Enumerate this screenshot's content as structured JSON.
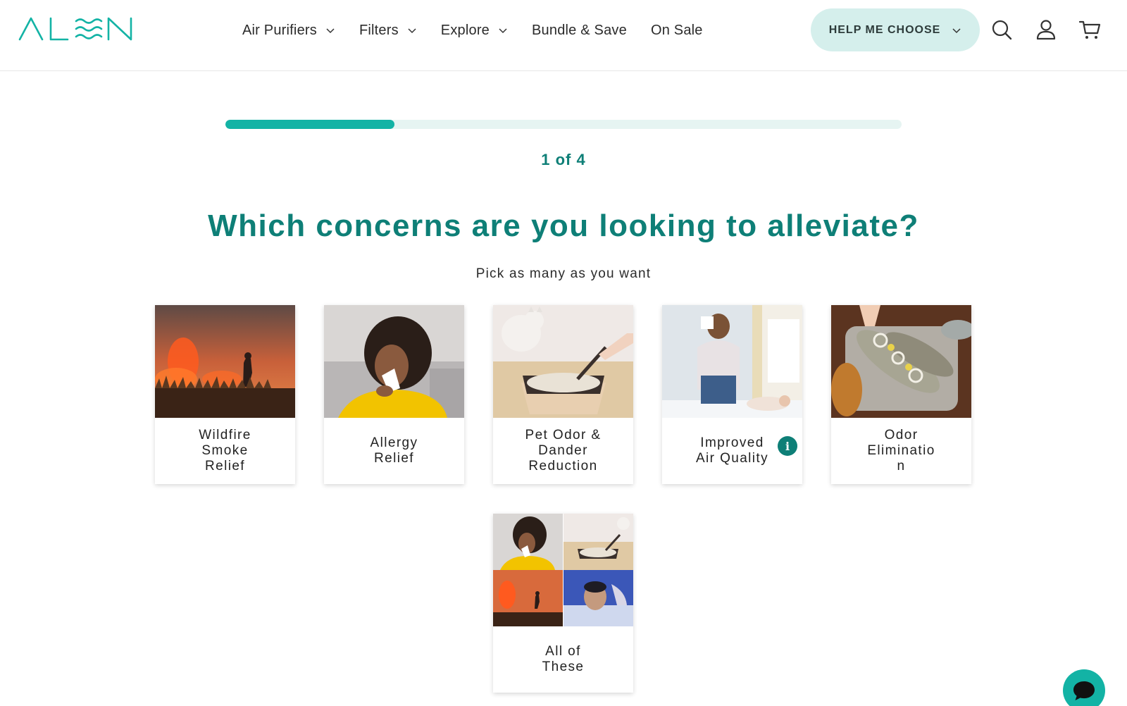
{
  "brand": {
    "logo_text": "ALEN",
    "accent": "#13b3a5",
    "dark_accent": "#0e7f77"
  },
  "nav": {
    "items": [
      {
        "label": "Air Purifiers",
        "has_dropdown": true
      },
      {
        "label": "Filters",
        "has_dropdown": true
      },
      {
        "label": "Explore",
        "has_dropdown": true
      },
      {
        "label": "Bundle & Save",
        "has_dropdown": false
      },
      {
        "label": "On Sale",
        "has_dropdown": false
      }
    ],
    "help_button": "HELP ME CHOOSE",
    "icons": [
      "search-icon",
      "account-icon",
      "cart-icon"
    ]
  },
  "quiz": {
    "progress_fraction": 0.25,
    "step_text": "1 of 4",
    "question": "Which concerns are you looking to alleviate?",
    "subtext": "Pick as many as you want",
    "options": [
      {
        "label": "Wildfire\nSmoke\nRelief",
        "image": "wildfire-firefighter-photo"
      },
      {
        "label": "Allergy\nRelief",
        "image": "woman-sneezing-photo"
      },
      {
        "label": "Pet Odor &\nDander\nReduction",
        "image": "cat-litter-box-photo"
      },
      {
        "label": "Improved\nAir Quality",
        "image": "mother-baby-nursery-photo",
        "info": "i"
      },
      {
        "label": "Odor\nEliminatio\nn",
        "image": "fish-dish-photo"
      },
      {
        "label": "All of\nThese",
        "image": "collage-photo"
      }
    ]
  },
  "chat": {
    "icon": "chat-bubble-icon"
  }
}
